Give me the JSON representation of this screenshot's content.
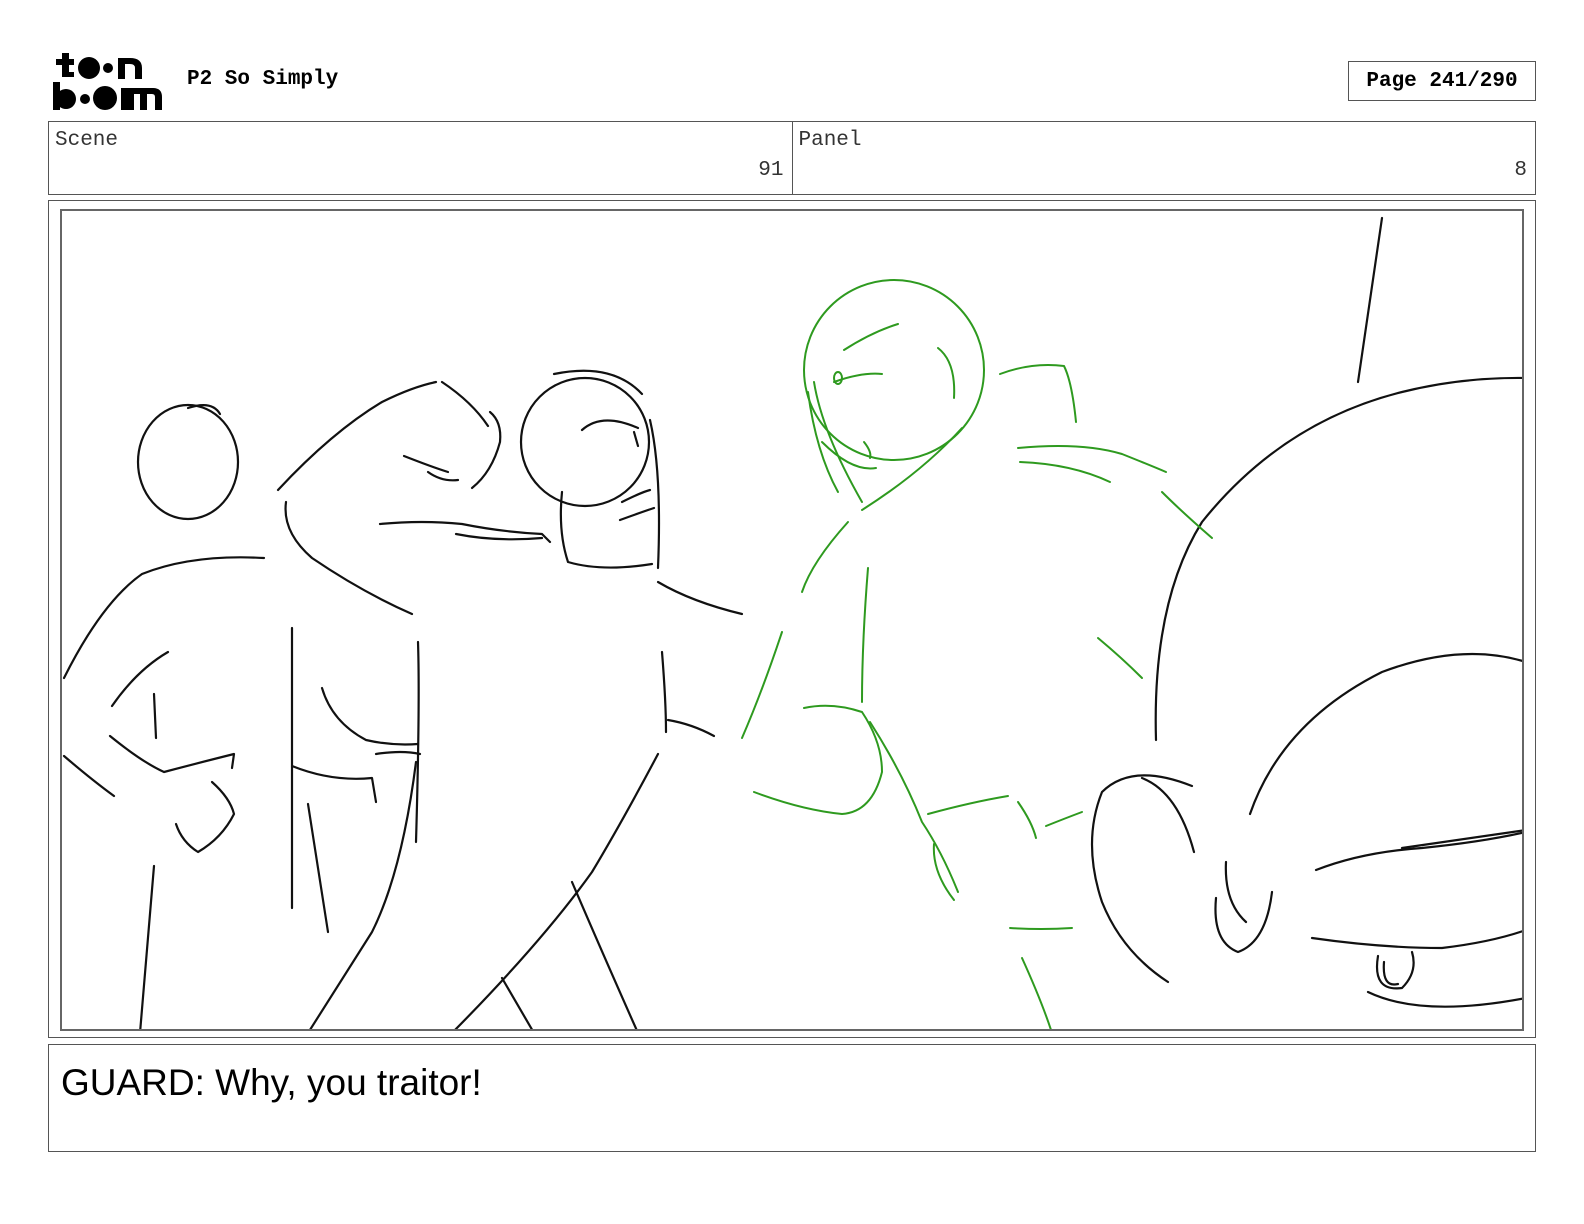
{
  "header": {
    "logo": {
      "line1": "toon",
      "line2": "boom",
      "icon": "toonboom-logo"
    },
    "project_title": "P2 So Simply",
    "page_label": "Page 241/290"
  },
  "info": {
    "scene_label": "Scene",
    "scene_value": "91",
    "panel_label": "Panel",
    "panel_value": "8"
  },
  "panel": {
    "content": "storyboard-sketch",
    "colors": {
      "ink": "#111111",
      "green_layer": "#2e9a1f",
      "frame": "#666666"
    }
  },
  "dialog": {
    "text": "GUARD: Why, you traitor!"
  }
}
